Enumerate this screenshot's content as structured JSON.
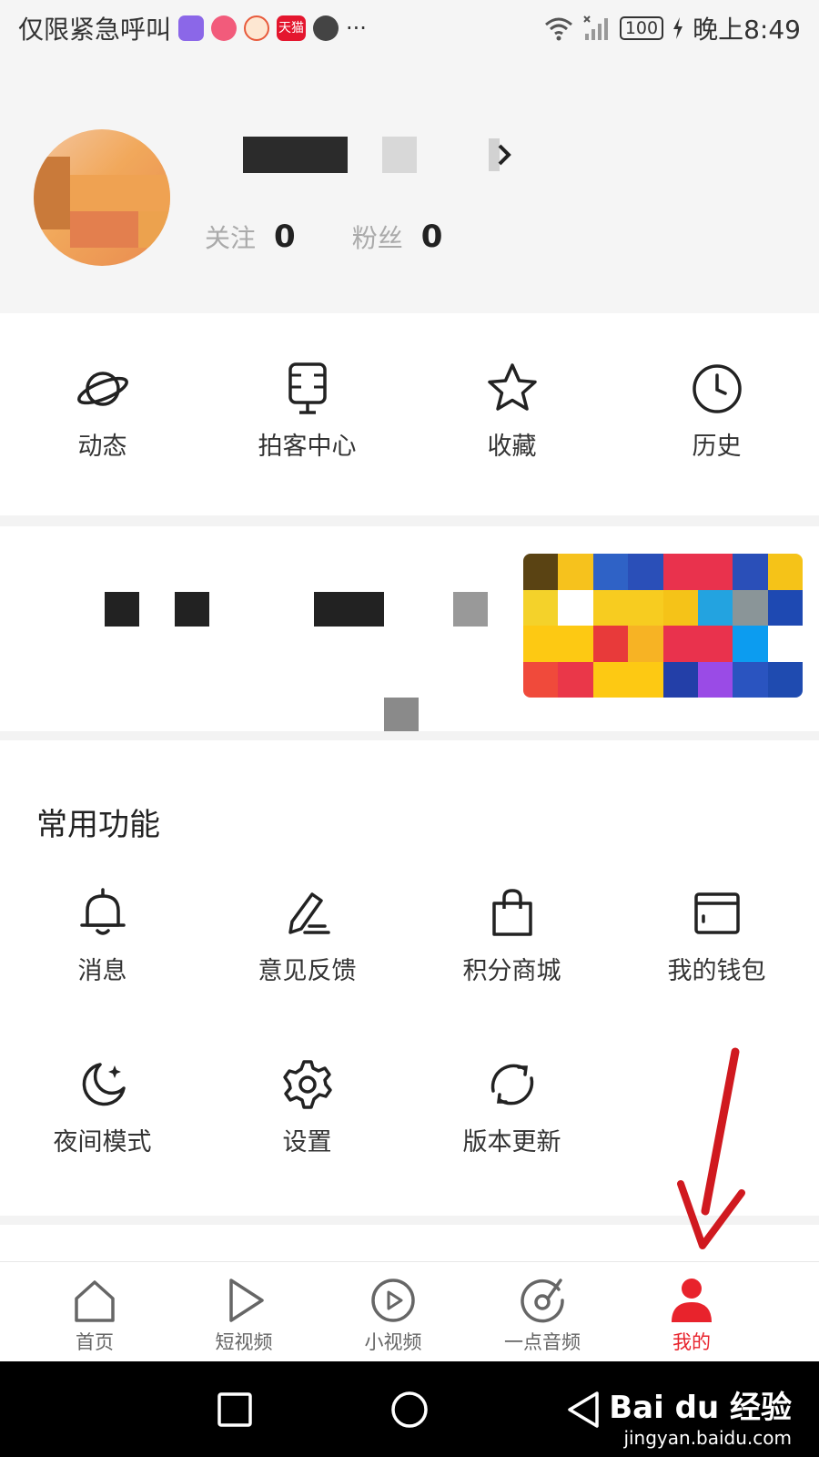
{
  "status_bar": {
    "left_text": "仅限紧急呼叫",
    "overflow": "···",
    "battery": "100",
    "time": "晚上8:49",
    "app_icons": [
      "soul-icon",
      "pinduoduo-icon",
      "netease-icon",
      "tmall-icon",
      "wechat-icon"
    ],
    "tmall_text": "天猫"
  },
  "profile": {
    "following_label": "关注",
    "following_count": "0",
    "followers_label": "粉丝",
    "followers_count": "0"
  },
  "quick_actions": [
    {
      "label": "动态",
      "icon": "planet-icon"
    },
    {
      "label": "拍客中心",
      "icon": "mic-board-icon"
    },
    {
      "label": "收藏",
      "icon": "star-icon"
    },
    {
      "label": "历史",
      "icon": "clock-icon"
    }
  ],
  "common_section": {
    "title": "常用功能",
    "items": [
      {
        "label": "消息",
        "icon": "bell-icon"
      },
      {
        "label": "意见反馈",
        "icon": "pen-icon"
      },
      {
        "label": "积分商城",
        "icon": "shopping-bag-icon"
      },
      {
        "label": "我的钱包",
        "icon": "wallet-icon"
      },
      {
        "label": "夜间模式",
        "icon": "moon-icon"
      },
      {
        "label": "设置",
        "icon": "gear-icon"
      },
      {
        "label": "版本更新",
        "icon": "refresh-icon"
      }
    ]
  },
  "bottom_nav": [
    {
      "label": "首页",
      "icon": "home-icon"
    },
    {
      "label": "短视频",
      "icon": "play-triangle-icon"
    },
    {
      "label": "小视频",
      "icon": "play-circle-icon"
    },
    {
      "label": "一点音频",
      "icon": "audio-disc-icon"
    },
    {
      "label": "我的",
      "icon": "person-icon",
      "active": true
    }
  ],
  "colors": {
    "accent": "#e8232c",
    "background_gray": "#f5f5f5",
    "annotation_arrow": "#d0191f"
  },
  "watermark": {
    "brand": "Bai du 经验",
    "url": "jingyan.baidu.com"
  }
}
